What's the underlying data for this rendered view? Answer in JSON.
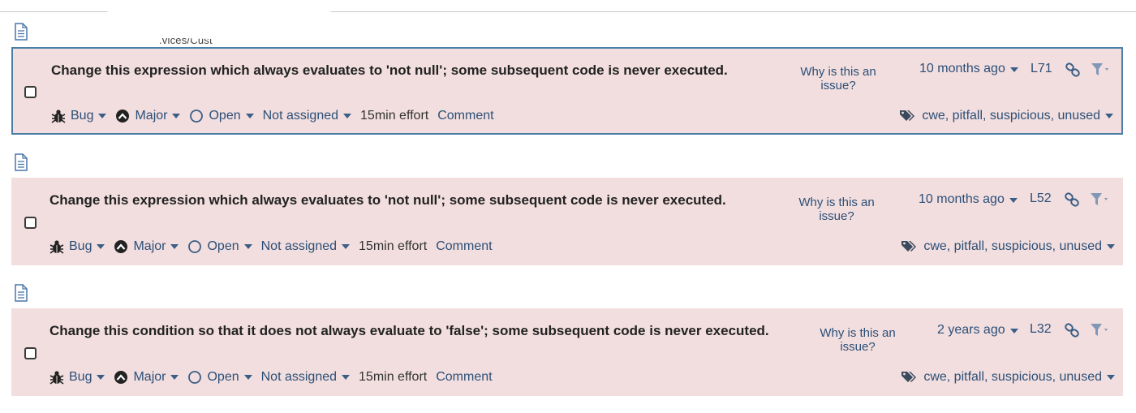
{
  "file_groups": [
    {
      "path": ".vices/Cust",
      "issue": {
        "message": "Change this expression which always evaluates to 'not null'; some subsequent code is never executed.",
        "why": "Why is this an issue?",
        "age": "10 months ago",
        "line": "L71",
        "type": "Bug",
        "severity": "Major",
        "status": "Open",
        "assignee": "Not assigned",
        "effort": "15min effort",
        "comment": "Comment",
        "tags": "cwe, pitfall, suspicious, unused",
        "selected": true
      }
    },
    {
      "path": "",
      "issue": {
        "message": "Change this expression which always evaluates to 'not null'; some subsequent code is never executed.",
        "why": "Why is this an issue?",
        "age": "10 months ago",
        "line": "L52",
        "type": "Bug",
        "severity": "Major",
        "status": "Open",
        "assignee": "Not assigned",
        "effort": "15min effort",
        "comment": "Comment",
        "tags": "cwe, pitfall, suspicious, unused",
        "selected": false
      }
    },
    {
      "path": "",
      "issue": {
        "message": "Change this condition so that it does not always evaluate to 'false'; some subsequent code is never executed.",
        "why": "Why is this an issue?",
        "age": "2 years ago",
        "line": "L32",
        "type": "Bug",
        "severity": "Major",
        "status": "Open",
        "assignee": "Not assigned",
        "effort": "15min effort",
        "comment": "Comment",
        "tags": "cwe, pitfall, suspicious, unused",
        "selected": false
      }
    }
  ],
  "colors": {
    "issue_background": "#f2dede",
    "selected_border": "#4b7fa6",
    "link_text": "#2b4f78",
    "message_text": "#222222"
  },
  "icons": {
    "file": "file-icon",
    "bug": "bug-icon",
    "severity": "major-severity-icon",
    "status": "open-status-icon",
    "link": "permalink-icon",
    "filter": "filter-icon",
    "tags": "tags-icon"
  }
}
